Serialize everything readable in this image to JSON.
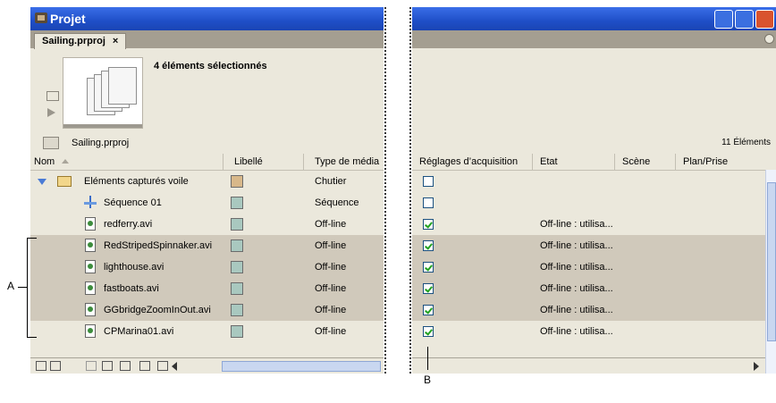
{
  "window": {
    "title": "Projet",
    "tab_label": "Sailing.prproj",
    "tab_close": "×"
  },
  "preview": {
    "info": "4 éléments sélectionnés"
  },
  "path_label": "Sailing.prproj",
  "item_count": "11 Éléments",
  "left_columns": {
    "name": "Nom",
    "label": "Libellé",
    "media_type": "Type de média"
  },
  "right_columns": {
    "capture": "Réglages d’acquisition",
    "status": "Etat",
    "scene": "Scène",
    "shot": "Plan/Prise"
  },
  "rows": [
    {
      "name": "Eléments capturés voile",
      "label_color": "#d8b88a",
      "type": "Chutier",
      "captured": false,
      "status": "",
      "selected": false,
      "kind": "bin"
    },
    {
      "name": "Séquence 01",
      "label_color": "#a9c8bf",
      "type": "Séquence",
      "captured": false,
      "status": "",
      "selected": false,
      "kind": "sequence"
    },
    {
      "name": "redferry.avi",
      "label_color": "#a9c8bf",
      "type": "Off-line",
      "captured": true,
      "status": "Off-line : utilisa...",
      "selected": false,
      "kind": "file"
    },
    {
      "name": "RedStripedSpinnaker.avi",
      "label_color": "#a9c8bf",
      "type": "Off-line",
      "captured": true,
      "status": "Off-line : utilisa...",
      "selected": true,
      "kind": "file"
    },
    {
      "name": "lighthouse.avi",
      "label_color": "#a9c8bf",
      "type": "Off-line",
      "captured": true,
      "status": "Off-line : utilisa...",
      "selected": true,
      "kind": "file"
    },
    {
      "name": "fastboats.avi",
      "label_color": "#a9c8bf",
      "type": "Off-line",
      "captured": true,
      "status": "Off-line : utilisa...",
      "selected": true,
      "kind": "file"
    },
    {
      "name": "GGbridgeZoomInOut.avi",
      "label_color": "#a9c8bf",
      "type": "Off-line",
      "captured": true,
      "status": "Off-line : utilisa...",
      "selected": true,
      "kind": "file"
    },
    {
      "name": "CPMarina01.avi",
      "label_color": "#a9c8bf",
      "type": "Off-line",
      "captured": true,
      "status": "Off-line : utilisa...",
      "selected": false,
      "kind": "file"
    }
  ],
  "callouts": {
    "a": "A",
    "b": "B"
  }
}
